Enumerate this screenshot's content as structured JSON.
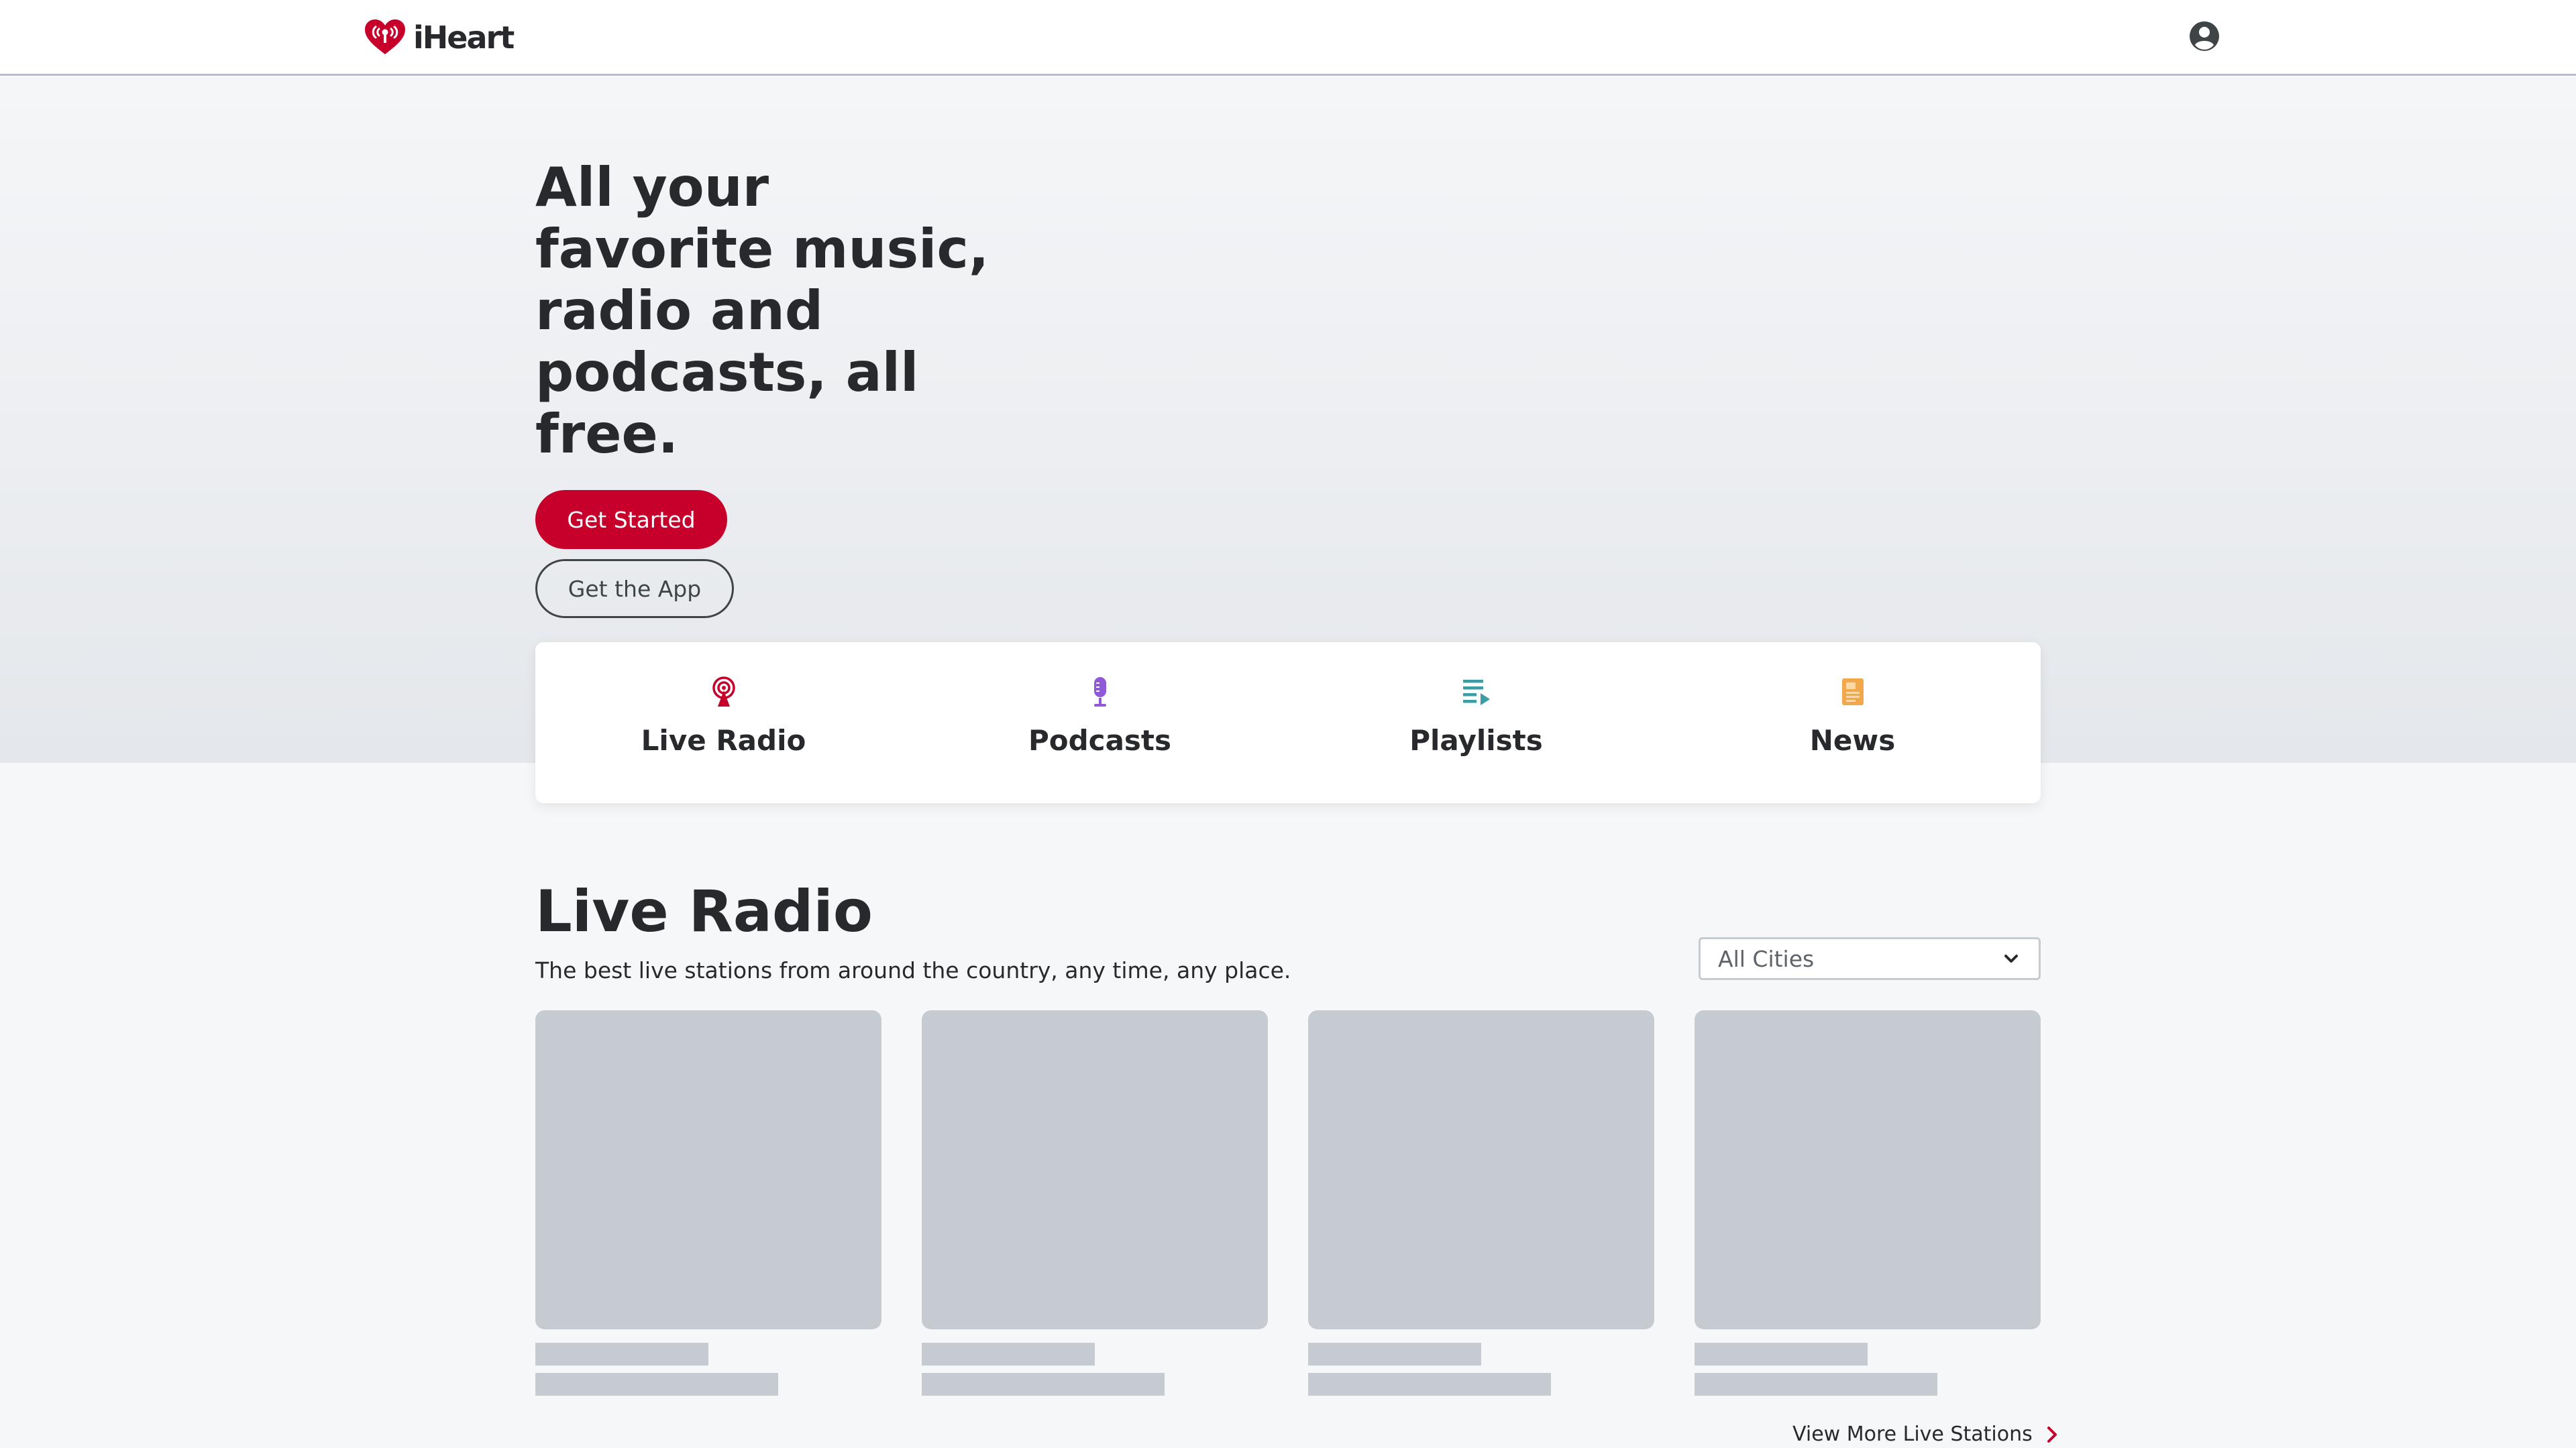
{
  "header": {
    "logo_text": "iHeart",
    "brand_color": "#c6002b",
    "account_icon": "user-circle-icon"
  },
  "hero": {
    "title": "All your favorite music, radio and podcasts, all free.",
    "get_started_label": "Get Started",
    "get_app_label": "Get the App"
  },
  "categories": [
    {
      "label": "Live Radio",
      "icon": "radio-tower-icon",
      "color": "#c6002b"
    },
    {
      "label": "Podcasts",
      "icon": "microphone-icon",
      "color": "#8f59d7"
    },
    {
      "label": "Playlists",
      "icon": "playlist-icon",
      "color": "#3a9ca5"
    },
    {
      "label": "News",
      "icon": "newspaper-icon",
      "color": "#f2a84a"
    }
  ],
  "live_radio": {
    "title": "Live Radio",
    "subtitle": "The best live stations from around the country, any time, any place.",
    "city_filter": {
      "selected": "All Cities",
      "icon": "chevron-down-icon"
    },
    "tiles_count": 4,
    "view_more_label": "View More Live Stations",
    "view_more_icon": "chevron-right-icon"
  }
}
